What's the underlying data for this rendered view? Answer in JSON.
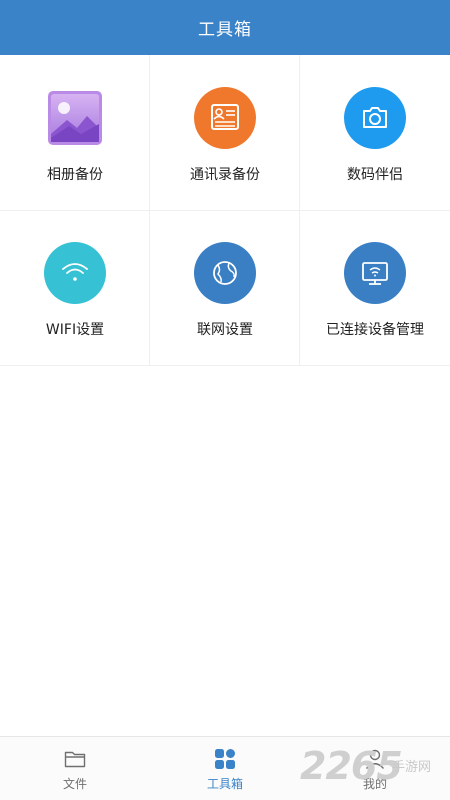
{
  "header": {
    "title": "工具箱"
  },
  "tools": [
    {
      "label": "相册备份",
      "icon": "photo-album-icon",
      "color": "#9b6bd6"
    },
    {
      "label": "通讯录备份",
      "icon": "contact-card-icon",
      "color": "#f0782c"
    },
    {
      "label": "数码伴侣",
      "icon": "camera-icon",
      "color": "#1e9bef"
    },
    {
      "label": "WIFI设置",
      "icon": "wifi-icon",
      "color": "#36c2d4"
    },
    {
      "label": "联网设置",
      "icon": "globe-icon",
      "color": "#3a7fc4"
    },
    {
      "label": "已连接设备管理",
      "icon": "monitor-wifi-icon",
      "color": "#3a7fc4"
    }
  ],
  "tabbar": {
    "tabs": [
      {
        "label": "文件",
        "icon": "folder-icon",
        "active": false
      },
      {
        "label": "工具箱",
        "icon": "grid-icon",
        "active": true
      },
      {
        "label": "我的",
        "icon": "user-icon",
        "active": false
      }
    ],
    "accent": "#3a83c8"
  },
  "watermark": {
    "number": "2265",
    "text": "手游网"
  }
}
